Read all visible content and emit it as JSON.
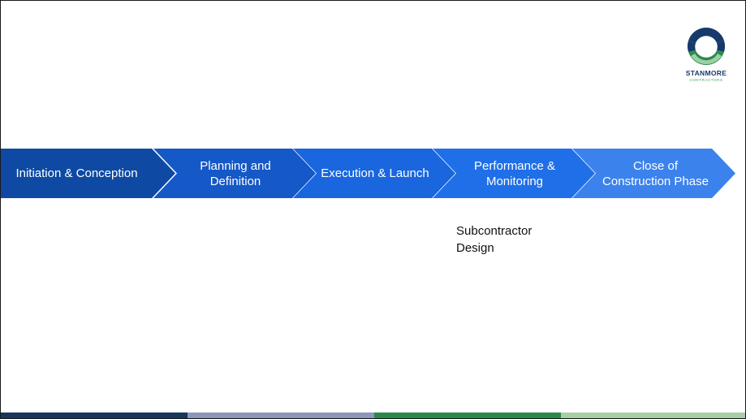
{
  "logo": {
    "name": "STANMORE",
    "sub": "CONTRACTORS",
    "ring_colors": [
      "#163a6b",
      "#2d8a4e",
      "#9bd0a6"
    ]
  },
  "phases": [
    {
      "label": "Initiation & Conception",
      "color": "#0e4aa3"
    },
    {
      "label": "Planning and Definition",
      "color": "#1558c7"
    },
    {
      "label": "Execution & Launch",
      "color": "#1966de"
    },
    {
      "label": "Performance & Monitoring",
      "color": "#1f6fe8"
    },
    {
      "label": "Close of Construction Phase",
      "color": "#3b82ec"
    }
  ],
  "notes": {
    "performance": "Subcontractor Design"
  },
  "footer_colors": [
    "#16365f",
    "#8b97bb",
    "#2b8a4b",
    "#a6cfa8"
  ]
}
